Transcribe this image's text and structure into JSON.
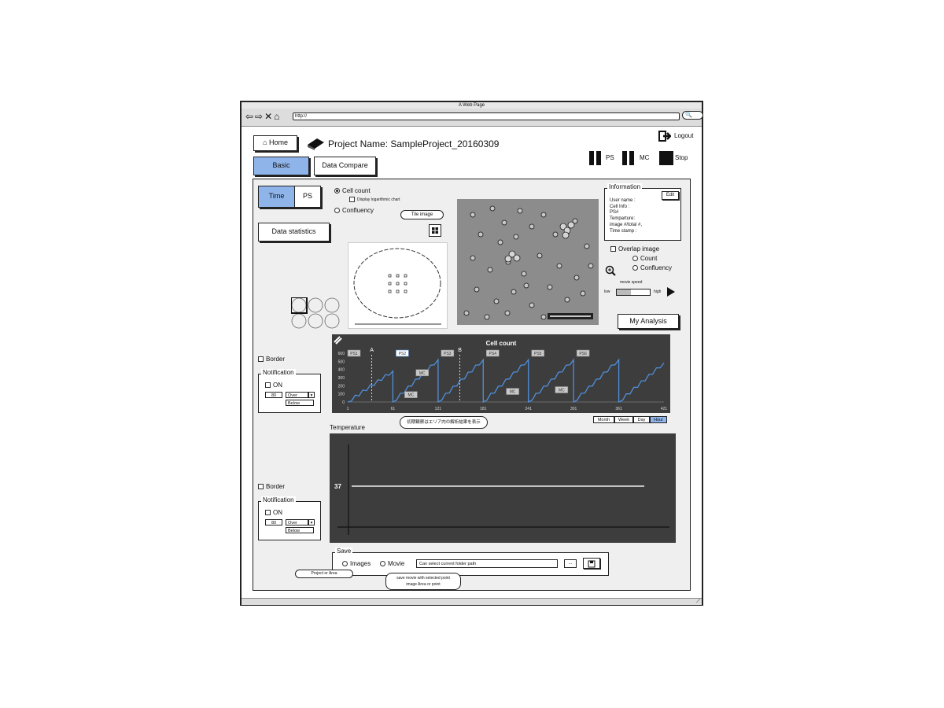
{
  "browser": {
    "title": "A Web Page",
    "nav_icons": "⇦⇨✕⌂",
    "url": "http://",
    "search_icon": "🔍"
  },
  "header": {
    "home_label": "Home",
    "project_title": "Project Name: SampleProject_20160309",
    "logout_label": "Logout",
    "ps_label": "PS",
    "mc_label": "MC",
    "stop_label": "Stop"
  },
  "tabs": {
    "basic": "Basic",
    "data_compare": "Data Compare"
  },
  "toggle": {
    "time": "Time",
    "ps": "PS"
  },
  "options": {
    "cell_count": "Cell count",
    "display_log": "Display logarithmic chart",
    "confluency": "Confluency",
    "tile_image": "Tile image"
  },
  "data_statistics": "Data statistics",
  "information": {
    "legend": "Information",
    "edit": "Edit",
    "lines": [
      "User name :",
      "Cell Info    :",
      "PS#",
      "Temparture:",
      "image  #/total #,",
      "Time stamp :"
    ]
  },
  "overlay": {
    "overlap_image": "Overlap image",
    "count": "Count",
    "confluency": "Confluency",
    "movie_speed": "movie speed",
    "low": "low",
    "high": "high"
  },
  "my_analysis": "My Analysis",
  "border_label": "Border",
  "notification": {
    "legend": "Notification",
    "on": "ON",
    "value": "80",
    "over": "Over",
    "below": "Below"
  },
  "chart_data": {
    "type": "line",
    "title": "Cell count",
    "x_ticks": [
      "1",
      "61",
      "121",
      "181",
      "241",
      "301",
      "361",
      "421"
    ],
    "y_ticks": [
      "600",
      "500",
      "400",
      "300",
      "200",
      "100",
      "0"
    ],
    "ylim": [
      0,
      600
    ],
    "markers": [
      {
        "label": "PS1",
        "x": 1
      },
      {
        "label": "PS2",
        "x": 61
      },
      {
        "label": "PS3",
        "x": 121
      },
      {
        "label": "PS4",
        "x": 181
      },
      {
        "label": "PS5",
        "x": 241
      },
      {
        "label": "PS6",
        "x": 301
      }
    ],
    "mc_labels": [
      {
        "label": "MC",
        "x": 85,
        "y": 90
      },
      {
        "label": "MC",
        "x": 100,
        "y": 360
      },
      {
        "label": "MC",
        "x": 220,
        "y": 130
      },
      {
        "label": "MC",
        "x": 285,
        "y": 150
      }
    ],
    "range_markers": [
      {
        "label": "A",
        "x": 33
      },
      {
        "label": "B",
        "x": 150
      }
    ],
    "cycles": [
      {
        "start": 1,
        "end": 61,
        "from": 0,
        "to": 380
      },
      {
        "start": 61,
        "end": 121,
        "from": 0,
        "to": 520
      },
      {
        "start": 121,
        "end": 181,
        "from": 0,
        "to": 520
      },
      {
        "start": 181,
        "end": 241,
        "from": 0,
        "to": 520
      },
      {
        "start": 241,
        "end": 301,
        "from": 0,
        "to": 520
      },
      {
        "start": 301,
        "end": 361,
        "from": 0,
        "to": 520
      },
      {
        "start": 361,
        "end": 421,
        "from": 0,
        "to": 480
      }
    ],
    "color": "#4f8fdc"
  },
  "chart_tooltip": "初期観察はエリア内の解析結果を表示",
  "time_buttons": [
    "Month",
    "Week",
    "Day",
    "Hour"
  ],
  "temperature": {
    "title": "Temperature",
    "value_label": "37"
  },
  "save": {
    "legend": "Save",
    "images": "Images",
    "movie": "Movie",
    "path_placeholder": "Can select current folder path",
    "browse": "...",
    "project_or_area": "Project or Area",
    "movie_tip_line1": "save movie with selected point",
    "movie_tip_line2": "image Area or point"
  }
}
